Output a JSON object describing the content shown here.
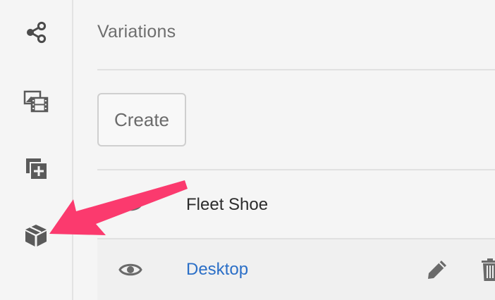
{
  "rail": {
    "items": [
      {
        "icon": "share-icon"
      },
      {
        "icon": "media-assets-icon"
      },
      {
        "icon": "add-copy-icon"
      },
      {
        "icon": "package-icon"
      }
    ]
  },
  "panel": {
    "title": "Variations",
    "create_label": "Create",
    "rows": [
      {
        "label": "Fleet Shoe",
        "icon": "eye-icon"
      },
      {
        "label": "Desktop",
        "icon": "eye-icon",
        "actions": [
          "pencil-icon",
          "trash-icon"
        ]
      }
    ]
  },
  "colors": {
    "background": "#f5f5f5",
    "link": "#2b6fc7",
    "callout_arrow": "#fb3a6e"
  }
}
